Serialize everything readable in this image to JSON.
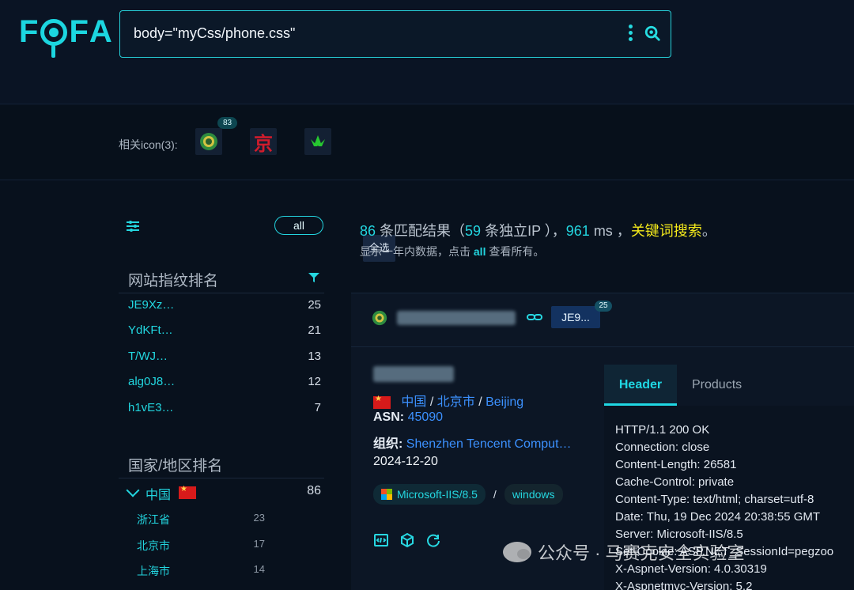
{
  "app": {
    "logo": [
      "F",
      "F",
      "A"
    ],
    "query": "body=\"myCss/phone.css\""
  },
  "icon_row": {
    "label": "相关icon(3):",
    "badge": "83",
    "icon2_text": "京",
    "select_all": "全选"
  },
  "sidebar": {
    "all": "all",
    "fingerprint_title": "网站指纹排名",
    "fingerprints": [
      {
        "name": "JE9Xz…",
        "count": "25"
      },
      {
        "name": "YdKFt…",
        "count": "21"
      },
      {
        "name": "T/WJ…",
        "count": "13"
      },
      {
        "name": "alg0J8…",
        "count": "12"
      },
      {
        "name": "h1vE3…",
        "count": "7"
      }
    ],
    "country_title": "国家/地区排名",
    "country": {
      "name": "中国",
      "count": "86"
    },
    "provinces": [
      {
        "name": "浙江省",
        "count": "23"
      },
      {
        "name": "北京市",
        "count": "17"
      },
      {
        "name": "上海市",
        "count": "14"
      }
    ]
  },
  "summary": {
    "results": "86",
    "results_label": " 条匹配结果（",
    "ips": "59",
    "ips_label": " 条独立IP ），",
    "ms": "961",
    "ms_label": " ms ，",
    "keyword": "关键词搜索",
    "end": "。",
    "line2_prefix": "显示一年内数据，点击",
    "line2_all": "all",
    "line2_suffix": "查看所有。"
  },
  "result": {
    "tag": "JE9...",
    "tag_badge": "25",
    "country": "中国",
    "city": "北京市",
    "city_en": "Beijing",
    "separator": "/",
    "asn_label": "ASN: ",
    "asn": "45090",
    "org_label": "组织: ",
    "org": "Shenzhen Tencent Comput…",
    "date": "2024-12-20",
    "tech1": "Microsoft-IIS/8.5",
    "tech_sep": "/",
    "tech2": "windows",
    "tab_header": "Header",
    "tab_products": "Products",
    "header_lines": [
      "HTTP/1.1 200 OK",
      "Connection: close",
      "Content-Length: 26581",
      "Cache-Control: private",
      "Content-Type: text/html; charset=utf-8",
      "Date: Thu, 19 Dec 2024 20:38:55 GMT",
      "Server: Microsoft-IIS/8.5",
      "Set-Cookie: ASP.NET_SessionId=pegzoo",
      "X-Aspnet-Version: 4.0.30319",
      "X-Aspnetmvc-Version: 5.2"
    ]
  },
  "watermark": "公众号 · 马赛克安全实验室",
  "colors": {
    "accent": "#23d6e0",
    "keyword": "#f3e91b",
    "link": "#3c91ff"
  }
}
